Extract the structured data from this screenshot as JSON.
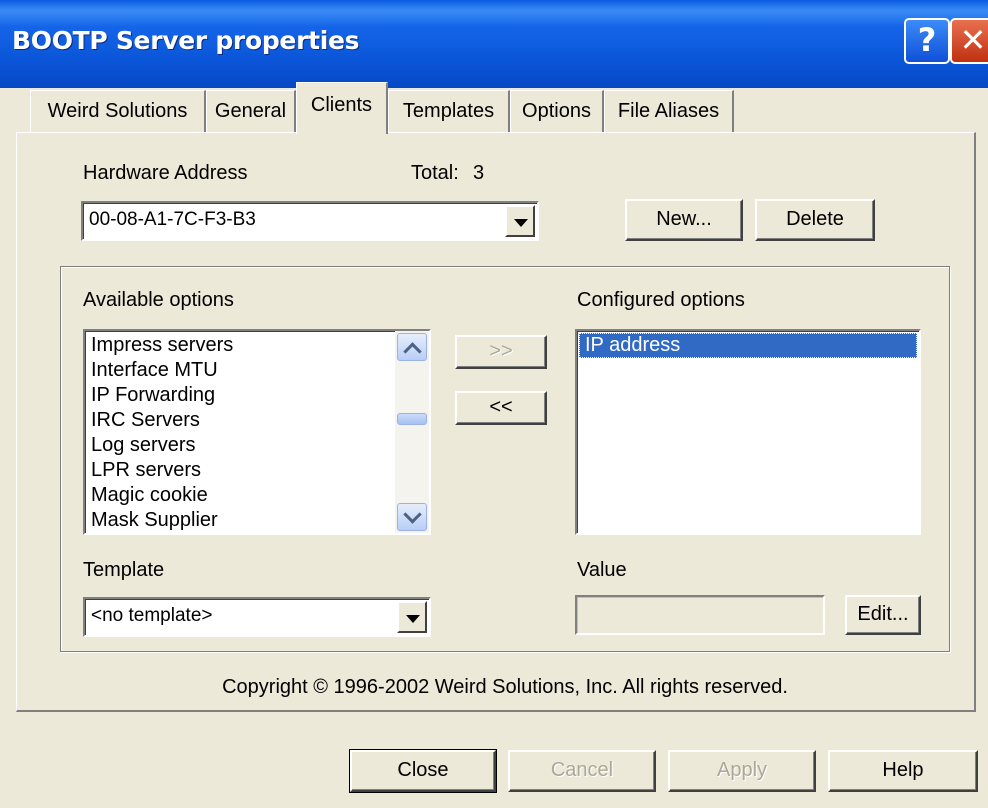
{
  "window": {
    "title": "BOOTP Server properties",
    "help_glyph": "?",
    "close_glyph": "✕"
  },
  "tabs": [
    {
      "label": "Weird Solutions"
    },
    {
      "label": "General"
    },
    {
      "label": "Clients",
      "active": true
    },
    {
      "label": "Templates"
    },
    {
      "label": "Options"
    },
    {
      "label": "File Aliases"
    }
  ],
  "clients": {
    "hardware_address_label": "Hardware Address",
    "total_label": "Total:",
    "total_value": "3",
    "hardware_address_value": "00-08-A1-7C-F3-B3",
    "new_button": "New...",
    "delete_button": "Delete",
    "available_label": "Available options",
    "available_items": [
      "Impress servers",
      "Interface MTU",
      "IP Forwarding",
      "IRC Servers",
      "Log servers",
      "LPR servers",
      "Magic cookie",
      "Mask Supplier"
    ],
    "add_button": ">>",
    "remove_button": "<<",
    "configured_label": "Configured options",
    "configured_items": [
      "IP address"
    ],
    "template_label": "Template",
    "template_value": "<no template>",
    "value_label": "Value",
    "value_field": "",
    "edit_button": "Edit...",
    "copyright": "Copyright © 1996-2002 Weird Solutions, Inc. All rights reserved."
  },
  "footer": {
    "close": "Close",
    "cancel": "Cancel",
    "apply": "Apply",
    "help": "Help"
  },
  "colors": {
    "titlebar": "#0a55d8",
    "selection": "#316ac5",
    "face": "#ece9d8"
  }
}
